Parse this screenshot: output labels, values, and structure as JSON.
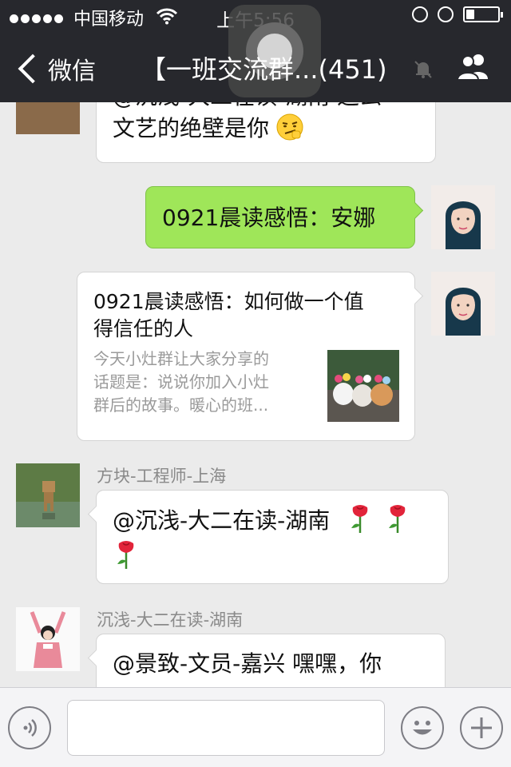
{
  "status_bar": {
    "carrier": "中国移动",
    "time": "上午5:56",
    "battery_level": 0.25
  },
  "nav": {
    "back_label": "微信",
    "title": "【一班交流群...(451)"
  },
  "messages": [
    {
      "type": "partial",
      "text_line1": "@沉浅-大二在读-湖南 这么",
      "text_line2": "文艺的绝壁是你",
      "emoji": "smirk-emoji"
    },
    {
      "type": "self_text",
      "text": "0921晨读感悟：安娜"
    },
    {
      "type": "self_link",
      "link_title_line1": "0921晨读感悟：如何做一个值",
      "link_title_line2": "得信任的人",
      "link_desc_line1": "今天小灶群让大家分享的",
      "link_desc_line2": "话题是：说说你加入小灶",
      "link_desc_line3": "群后的故事。暖心的班..."
    },
    {
      "type": "other",
      "sender": "方块-工程师-上海",
      "text": "@沉浅-大二在读-湖南",
      "emoji": "rose-emoji"
    },
    {
      "type": "other",
      "sender": "沉浅-大二在读-湖南",
      "text": "@景致-文员-嘉兴 嘿嘿，你"
    }
  ],
  "input": {
    "placeholder": ""
  },
  "colors": {
    "nav_bg": "#27282d",
    "chat_bg": "#ebebeb",
    "self_bubble": "#9fe659"
  }
}
